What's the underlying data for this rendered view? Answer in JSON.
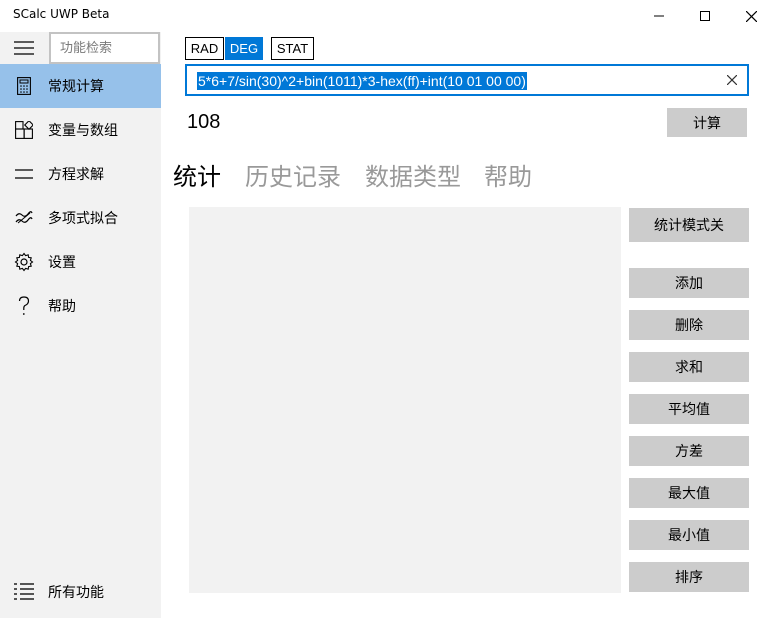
{
  "window": {
    "title": "SCalc UWP Beta"
  },
  "sidebar": {
    "search_placeholder": "功能检索",
    "items": [
      {
        "label": "常规计算",
        "icon": "calculator-icon"
      },
      {
        "label": "变量与数组",
        "icon": "shapes-icon"
      },
      {
        "label": "方程求解",
        "icon": "equals-icon"
      },
      {
        "label": "多项式拟合",
        "icon": "wave-icon"
      },
      {
        "label": "设置",
        "icon": "gear-icon"
      },
      {
        "label": "帮助",
        "icon": "question-icon"
      }
    ],
    "all_features": {
      "label": "所有功能",
      "icon": "list-icon"
    },
    "active_color": "#96c1ea"
  },
  "modes": {
    "rad": "RAD",
    "deg": "DEG",
    "stat": "STAT",
    "selected": "DEG"
  },
  "expression": {
    "value": "5*6+7/sin(30)^2+bin(1011)*3-hex(ff)+int(10 01 00 00)"
  },
  "result": {
    "value": "108"
  },
  "calc_button": "计算",
  "tabs": [
    {
      "label": "统计",
      "active": true
    },
    {
      "label": "历史记录",
      "active": false
    },
    {
      "label": "数据类型",
      "active": false
    },
    {
      "label": "帮助",
      "active": false
    }
  ],
  "stat_panel": {
    "toggle": "统计模式关",
    "buttons": [
      "添加",
      "删除",
      "求和",
      "平均值",
      "方差",
      "最大值",
      "最小值",
      "排序"
    ]
  },
  "accent_color": "#0078d7"
}
